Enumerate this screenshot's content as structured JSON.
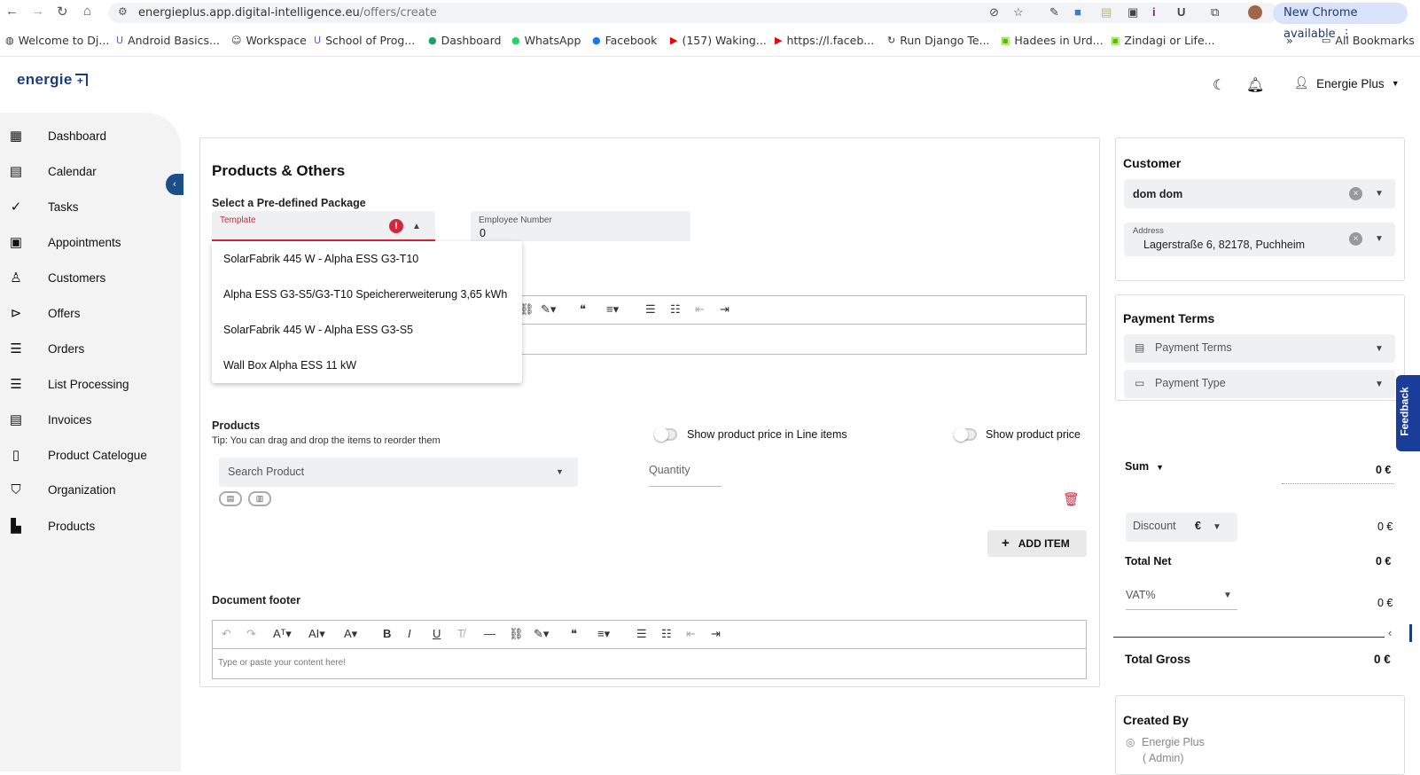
{
  "browser": {
    "url_host": "energieplus.app.digital-intelligence.eu",
    "url_path": "/offers/create",
    "new_chrome": "New Chrome available",
    "bookmarks": [
      "Welcome to Dj...",
      "Android Basics...",
      "Workspace",
      "School of Prog...",
      "Dashboard",
      "WhatsApp",
      "Facebook",
      "(157) Waking...",
      "https://l.faceb...",
      "Run Django Te...",
      "Hadees in Urd...",
      "Zindagi or Life..."
    ],
    "all_bookmarks": "All Bookmarks",
    "more": "»"
  },
  "app": {
    "logo": "energie",
    "user": "Energie Plus"
  },
  "sidebar": {
    "items": [
      {
        "label": "Dashboard",
        "icon": "grid-icon"
      },
      {
        "label": "Calendar",
        "icon": "calendar-icon"
      },
      {
        "label": "Tasks",
        "icon": "tasks-icon"
      },
      {
        "label": "Appointments",
        "icon": "appointments-icon"
      },
      {
        "label": "Customers",
        "icon": "customers-icon"
      },
      {
        "label": "Offers",
        "icon": "offers-icon"
      },
      {
        "label": "Orders",
        "icon": "orders-icon"
      },
      {
        "label": "List Processing",
        "icon": "list-icon"
      },
      {
        "label": "Invoices",
        "icon": "invoices-icon"
      },
      {
        "label": "Product Catelogue",
        "icon": "catalogue-icon"
      },
      {
        "label": "Organization",
        "icon": "shield-icon"
      },
      {
        "label": "Products",
        "icon": "products-icon"
      }
    ]
  },
  "main": {
    "title": "Products & Others",
    "package_label": "Select a Pre-defined Package",
    "template_label": "Template",
    "employee_label": "Employee Number",
    "employee_value": "0",
    "dropdown_options": [
      "SolarFabrik 445 W - Alpha ESS G3-T10",
      "Alpha ESS G3-S5/G3-T10 Speichererweiterung 3,65 kWh",
      "SolarFabrik 445 W - Alpha ESS G3-S5",
      "Wall Box Alpha ESS 11 kW"
    ],
    "products_label": "Products",
    "products_tip": "Tip: You can drag and drop the items to reorder them",
    "show_price_line": "Show product price in Line items",
    "show_price": "Show product price",
    "search_product": "Search Product",
    "quantity": "Quantity",
    "add_item": "ADD ITEM",
    "footer_label": "Document footer",
    "footer_placeholder": "Type or paste your content here!"
  },
  "right": {
    "customer_title": "Customer",
    "customer_value": "dom dom",
    "address_label": "Address",
    "address_value": "Lagerstraße 6, 82178, Puchheim",
    "payment_title": "Payment Terms",
    "payment_terms": "Payment Terms",
    "payment_type": "Payment Type",
    "sum_label": "Sum",
    "sum_value": "0 €",
    "discount_label": "Discount",
    "discount_unit": "€",
    "discount_value": "0 €",
    "total_net_label": "Total Net",
    "total_net_value": "0 €",
    "vat_label": "VAT%",
    "vat_value": "0 €",
    "total_gross_label": "Total Gross",
    "total_gross_value": "0 €",
    "created_by_title": "Created By",
    "created_by_name": "Energie Plus",
    "created_by_role": "( Admin)",
    "feedback": "Feedback"
  },
  "colors": {
    "accent": "#1b3d7a",
    "error": "#d2283f"
  }
}
